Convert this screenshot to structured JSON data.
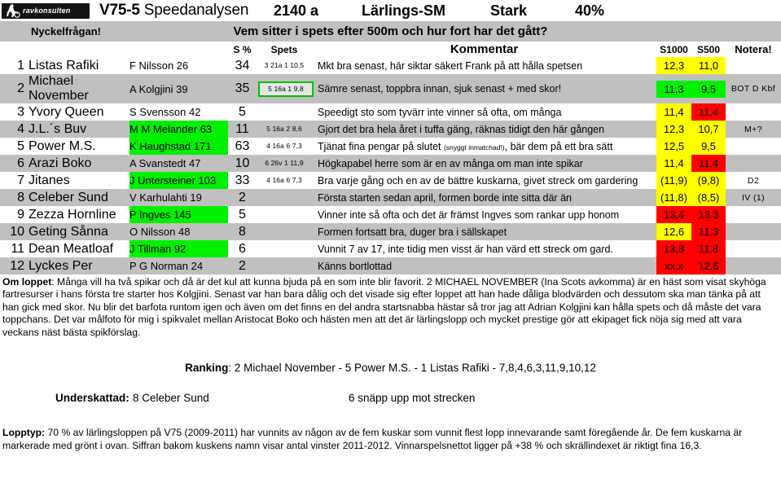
{
  "header": {
    "logo_text": "ravkonsulten",
    "logo_icon": "horse-sulky-icon",
    "race_code": "V75-5",
    "doc_title": "Speedanalysen",
    "distance": "2140 a",
    "race_name": "Lärlings-SM",
    "pace": "Stark",
    "percent": "40%"
  },
  "keyquestion": {
    "label": "Nyckelfrågan!",
    "question": "Vem sitter i spets efter 500m och hur fort har det gått?"
  },
  "table": {
    "columns": {
      "num": "",
      "horse": "",
      "driver": "",
      "spct": "S %",
      "spets": "Spets",
      "comment": "Kommentar",
      "s1000": "S1000",
      "s500": "S500",
      "notera": "Notera!"
    },
    "rows": [
      {
        "num": "1",
        "horse": "Listas Rafiki",
        "driver": "F Nilsson  26",
        "driver_hl": "none",
        "spct": "34",
        "spets": "3 21a 1 10,5",
        "spets_box": false,
        "comment": "Mkt bra senast, här siktar säkert Frank på att hålla spetsen",
        "s1000": "12,3",
        "s1000_hl": "yellow",
        "s500": "11,0",
        "s500_hl": "yellow",
        "notera": ""
      },
      {
        "num": "2",
        "horse": "Michael November",
        "driver": "A Kolgjini  39",
        "driver_hl": "none",
        "spct": "35",
        "spets": "5 16a 1 9,8",
        "spets_box": true,
        "comment": "Sämre senast, toppbra innan, sjuk senast + med skor!",
        "s1000": "11,3",
        "s1000_hl": "green",
        "s500": "9,5",
        "s500_hl": "green",
        "notera": "BOT  D  Kbf"
      },
      {
        "num": "3",
        "horse": "Yvory Queen",
        "driver": "S Svensson  42",
        "driver_hl": "none",
        "spct": "5",
        "spets": "",
        "spets_box": false,
        "comment": "Speedigt sto som tyvärr inte vinner så ofta, om många",
        "s1000": "11,4",
        "s1000_hl": "yellow",
        "s500": "11,4",
        "s500_hl": "red",
        "notera": ""
      },
      {
        "num": "4",
        "horse": "J.L.´s Buv",
        "driver": "M M Melander 63",
        "driver_hl": "green",
        "spct": "11",
        "spets": "5 16a 2  8,6",
        "spets_box": false,
        "comment": "Gjort det bra hela året i tuffa gäng, räknas tidigt den här gången",
        "s1000": "12,3",
        "s1000_hl": "yellow",
        "s500": "10,7",
        "s500_hl": "yellow",
        "notera": "M+?"
      },
      {
        "num": "5",
        "horse": "Power M.S.",
        "driver": "K Haughstad  171",
        "driver_hl": "green",
        "spct": "63",
        "spets": "4 16a 6 7,3",
        "spets_box": false,
        "comment": "Tjänat fina pengar på slutet ",
        "comment_small": "(snyggt inmatchad!)",
        "comment_tail": ", bär dem på ett bra sätt",
        "s1000": "12,5",
        "s1000_hl": "yellow",
        "s500": "9,5",
        "s500_hl": "yellow",
        "notera": ""
      },
      {
        "num": "6",
        "horse": "Arazi Boko",
        "driver": "A Svanstedt  47",
        "driver_hl": "none",
        "spct": "10",
        "spets": "6 26v 1 11,9",
        "spets_box": false,
        "comment": "Högkapabel herre som är en av många om man inte spikar",
        "s1000": "11,4",
        "s1000_hl": "yellow",
        "s500": "11,4",
        "s500_hl": "red",
        "notera": ""
      },
      {
        "num": "7",
        "horse": "Jitanes",
        "driver": "J Untersteiner 103",
        "driver_hl": "green",
        "spct": "33",
        "spets": "4 16a 6 7,3",
        "spets_box": false,
        "comment": "Bra varje gång och en av de bättre kuskarna, givet streck om gardering",
        "s1000": "(11,9)",
        "s1000_hl": "yellow",
        "s500": "(9,8)",
        "s500_hl": "yellow",
        "notera": "D2"
      },
      {
        "num": "8",
        "horse": "Celeber Sund",
        "driver": "V Karhulahti  19",
        "driver_hl": "none",
        "spct": "2",
        "spets": "",
        "spets_box": false,
        "comment": "Första starten sedan april, formen borde inte sitta där än",
        "s1000": "(11,8)",
        "s1000_hl": "yellow",
        "s500": "(8,5)",
        "s500_hl": "yellow",
        "notera": "IV (1)"
      },
      {
        "num": "9",
        "horse": "Zezza Hornline",
        "driver": "P Ingves  145",
        "driver_hl": "green",
        "spct": "5",
        "spets": "",
        "spets_box": false,
        "comment": "Vinner inte så ofta och det är främst Ingves som rankar upp honom",
        "s1000": "13,4",
        "s1000_hl": "red",
        "s500": "13,3",
        "s500_hl": "red",
        "notera": ""
      },
      {
        "num": "10",
        "horse": "Geting Sånna",
        "driver": "O Nilsson  48",
        "driver_hl": "none",
        "spct": "8",
        "spets": "",
        "spets_box": false,
        "comment": "Formen fortsatt bra, duger bra i sällskapet",
        "s1000": "12,6",
        "s1000_hl": "yellow",
        "s500": "11,3",
        "s500_hl": "red",
        "notera": ""
      },
      {
        "num": "11",
        "horse": "Dean Meatloaf",
        "driver": "J Tillman  92",
        "driver_hl": "green",
        "spct": "6",
        "spets": "",
        "spets_box": false,
        "comment": "Vunnit 7 av 17, inte tidig men visst är han värd ett streck om gard.",
        "s1000": "13,8",
        "s1000_hl": "red",
        "s500": "11,8",
        "s500_hl": "red",
        "notera": ""
      },
      {
        "num": "12",
        "horse": "Lyckes Per",
        "driver": "P G Norman  24",
        "driver_hl": "none",
        "spct": "2",
        "spets": "",
        "spets_box": false,
        "comment": "Känns bortlottad",
        "s1000": "xx,x",
        "s1000_hl": "red",
        "s500": "12,6",
        "s500_hl": "red",
        "notera": ""
      }
    ]
  },
  "about": {
    "label": "Om loppet",
    "text": ": Många vill ha två spikar och då är det kul att kunna bjuda på en som inte blir favorit. 2 MICHAEL NOVEMBER (Ina Scots avkomma) är en häst som visat skyhöga fartresurser i hans första tre starter hos Kolgjini. Senast var han bara dålig och det visade sig efter loppet att han hade dåliga blodvärden och dessutom ska man tänka på att han gick med skor. Nu blir det barfota runtom igen och även om det finns en del andra startsnabba hästar så tror jag att Adrian Kolgjini kan hålla spets och då måste det vara toppchans. Det var målfoto för mig i spikvalet mellan Aristocat Boko och hästen men att det är lärlingslopp och mycket prestige gör att ekipaget fick nöja sig med att vara veckans näst bästa spikförslag."
  },
  "ranking": {
    "label": "Ranking",
    "text": ": 2 Michael November - 5 Power M.S. - 1 Listas Rafiki - 7,8,4,6,3,11,9,10,12"
  },
  "underrated": {
    "label": "Underskattad:",
    "value": "8 Celeber Sund",
    "note": "6 snäpp upp mot strecken"
  },
  "racetype": {
    "label": "Lopptyp:",
    "text": " 70 % av lärlingsloppen på V75 (2009-2011) har vunnits av någon av de fem kuskar som vunnit flest lopp innevarande samt föregående år. De fem kuskarna är markerade med grönt i ovan. Siffran bakom kuskens namn visar antal vinster 2011-2012. Vinnarspelsnettot ligger på +38 % och skrällindexet är riktigt fina 16,3."
  },
  "colors": {
    "green": "#00f000",
    "yellow": "#ffff00",
    "red": "#ff0000",
    "rowgray": "#c0c0c0"
  }
}
